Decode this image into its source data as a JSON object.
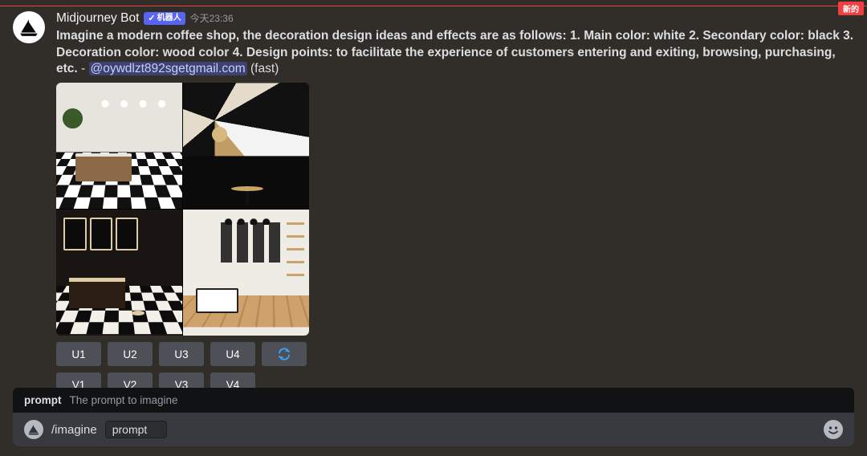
{
  "badge": {
    "new": "新的"
  },
  "message": {
    "author": "Midjourney Bot",
    "bot_tag": "机器人",
    "timestamp": "今天23:36",
    "prompt_bold": "Imagine a modern coffee shop, the decoration design ideas and effects are as follows: 1. Main color: white 2. Secondary color: black 3. Decoration color: wood color 4. Design points: to facilitate the experience of customers entering and exiting, browsing, purchasing, etc.",
    "separator": " - ",
    "mention": "@oywdlzt892sgetgmail.com",
    "suffix": " (fast)"
  },
  "buttons": {
    "u": [
      "U1",
      "U2",
      "U3",
      "U4"
    ],
    "v": [
      "V1",
      "V2",
      "V3",
      "V4"
    ],
    "refresh_icon": "refresh-icon"
  },
  "composer": {
    "hint_label": "prompt",
    "hint_desc": "The prompt to imagine",
    "command": "/imagine",
    "param_name": "prompt",
    "param_value": ""
  }
}
